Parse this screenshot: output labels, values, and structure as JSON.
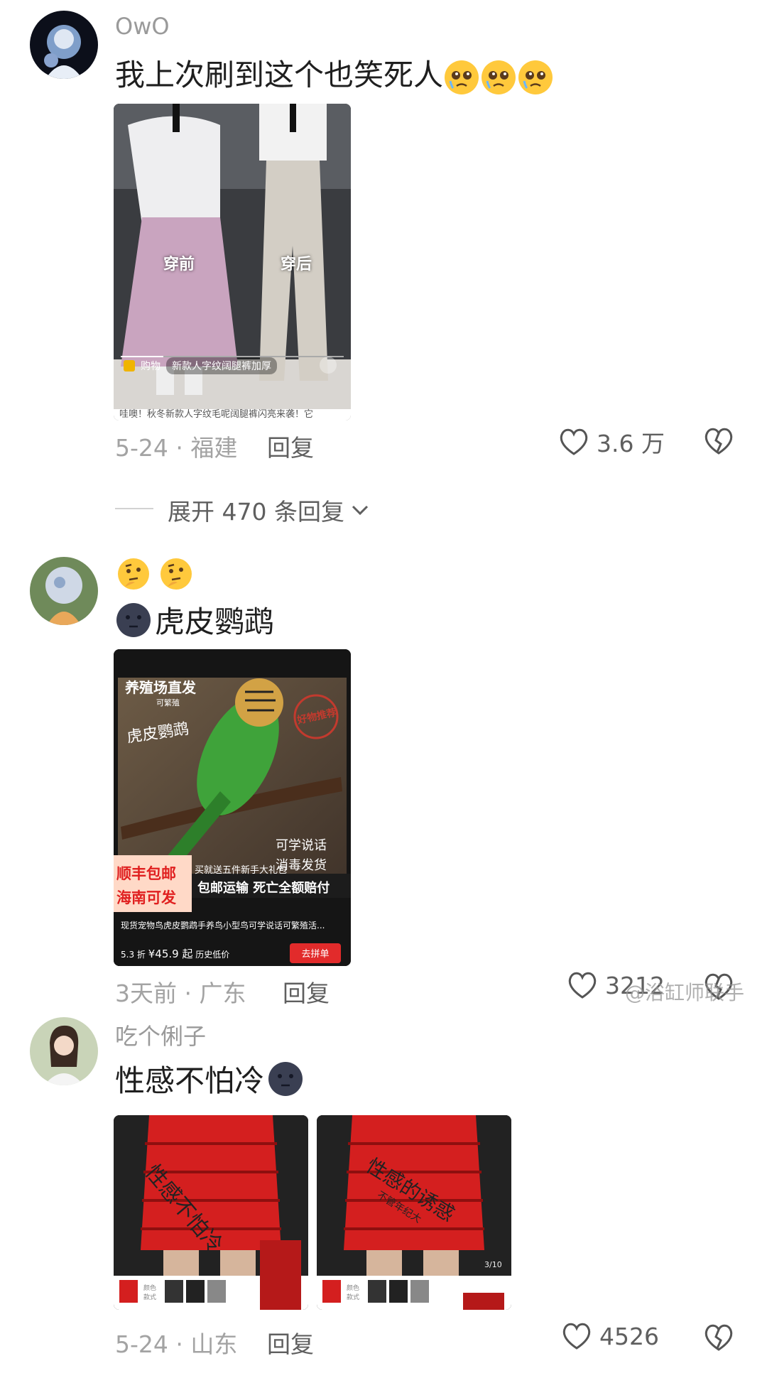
{
  "comments": [
    {
      "username": "OwO",
      "text": "我上次刷到这个也笑死人",
      "date": "5-24",
      "location": "福建",
      "reply_label": "回复",
      "likes": "3.6 万",
      "image": {
        "label_before": "穿前",
        "label_after": "穿后",
        "shop_label": "购物",
        "shop_title": "新款人字纹阔腿裤加厚",
        "caption": "哇噢！秋冬新款人字纹毛呢阔腿裤闪亮来袭！它"
      }
    },
    {
      "username": "",
      "text": "虎皮鹦鹉",
      "date": "3天前",
      "location": "广东",
      "reply_label": "回复",
      "likes": "3212",
      "watermark": "@浴缸师联手",
      "image": {
        "top_title": "养殖场直发",
        "top_sub": "可繁殖",
        "bird_label": "虎皮鹦鹉",
        "stamp": "好物推荐",
        "right_line1": "可学说话",
        "right_line2": "消毒发货",
        "badge1": "顺丰包邮",
        "badge2": "海南可发",
        "gift": "买就送五件新手大礼包",
        "guarantee": "包邮运输 死亡全额赔付",
        "product_title": "现货宠物鸟虎皮鹦鹉手养鸟小型鸟可学说话可繁殖活...",
        "discount": "5.3 折",
        "price": "¥45.9 起",
        "price_note": "历史低价",
        "button": "去拼单"
      }
    },
    {
      "username": "吃个俐子",
      "text": "性感不怕冷",
      "date": "5-24",
      "location": "山东",
      "reply_label": "回复",
      "likes": "4526",
      "images": [
        {
          "overlay": "性感不怕冷",
          "color_label": "颜色\n款式"
        },
        {
          "overlay": "性感的诱惑",
          "overlay_sub": "不管年纪大",
          "counter": "3/10",
          "color_label": "颜色\n款式"
        }
      ]
    }
  ],
  "expand_replies": "展开 470 条回复"
}
